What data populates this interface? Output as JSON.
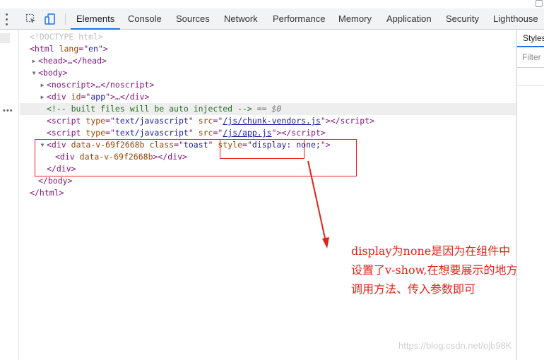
{
  "toolbar": {
    "tabs": [
      {
        "label": "Elements",
        "active": true
      },
      {
        "label": "Console"
      },
      {
        "label": "Sources"
      },
      {
        "label": "Network"
      },
      {
        "label": "Performance"
      },
      {
        "label": "Memory"
      },
      {
        "label": "Application"
      },
      {
        "label": "Security"
      },
      {
        "label": "Lighthouse"
      }
    ]
  },
  "styles_panel": {
    "tab_label": "Styles",
    "filter_placeholder": "Filter"
  },
  "dom": {
    "doctype": "<!DOCTYPE html>",
    "html_open": {
      "tag": "<html",
      "attr": "lang",
      "value": "en",
      "close": ">"
    },
    "head_collapsed": "<head>…</head>",
    "body_open": "<body>",
    "noscript_collapsed": "<noscript>…</noscript>",
    "div_app": {
      "open": "<div",
      "attr": "id",
      "value": "app",
      "rest": ">…</div>"
    },
    "comment": "<!-- built files will be auto injected -->",
    "selected_marker": " == $0",
    "script1": {
      "attr1": "type",
      "val1": "text/javascript",
      "attr2": "src",
      "val2": "/js/chunk-vendors.js"
    },
    "script2": {
      "attr1": "type",
      "val1": "text/javascript",
      "attr2": "src",
      "val2": "/js/app.js"
    },
    "toast_div": {
      "attr1": "data-v-69f2668b",
      "attr2": "class",
      "val2": "toast",
      "attr3": "style",
      "val3": "display: none;"
    },
    "inner_div": {
      "attr1": "data-v-69f2668b"
    },
    "div_close": "</div>",
    "body_close": "</body>",
    "html_close": "</html>"
  },
  "annotation": {
    "lines": [
      "display为none是因为在组件中",
      "设置了v-show,在想要展示的地方",
      "调用方法、传入参数即可"
    ],
    "color": "#e2231a"
  },
  "watermark": "https://blog.csdn.net/ojb98K"
}
